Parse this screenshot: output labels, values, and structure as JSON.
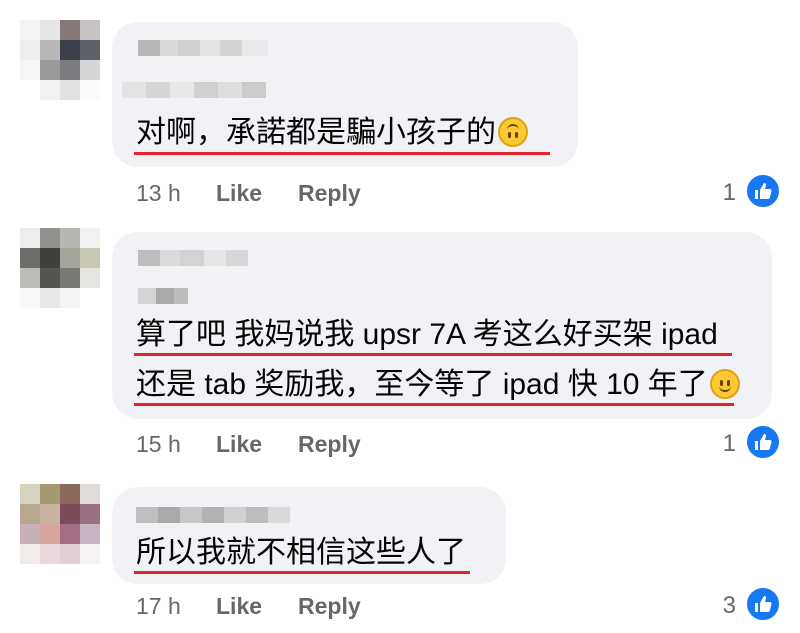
{
  "colors": {
    "bubble": "#f0f2f5",
    "text": "#050505",
    "meta": "#65676b",
    "underline": "#e3242b",
    "like_blue": "#1877f2"
  },
  "comments": [
    {
      "lines": [
        "对啊，承諾都是騙小孩子的"
      ],
      "emoji": "upside-down-face-emoji",
      "time": "13 h",
      "like_label": "Like",
      "reply_label": "Reply",
      "reaction_count": "1",
      "reaction_icon": "like-icon"
    },
    {
      "lines": [
        "算了吧 我妈说我 upsr 7A 考这么好买架 ipad",
        "还是 tab 奖励我，至今等了 ipad 快 10 年了"
      ],
      "emoji": "slightly-smiling-face-emoji",
      "time": "15 h",
      "like_label": "Like",
      "reply_label": "Reply",
      "reaction_count": "1",
      "reaction_icon": "like-icon"
    },
    {
      "lines": [
        "所以我就不相信这些人了"
      ],
      "emoji": "",
      "time": "17 h",
      "like_label": "Like",
      "reply_label": "Reply",
      "reaction_count": "3",
      "reaction_icon": "like-icon"
    }
  ]
}
